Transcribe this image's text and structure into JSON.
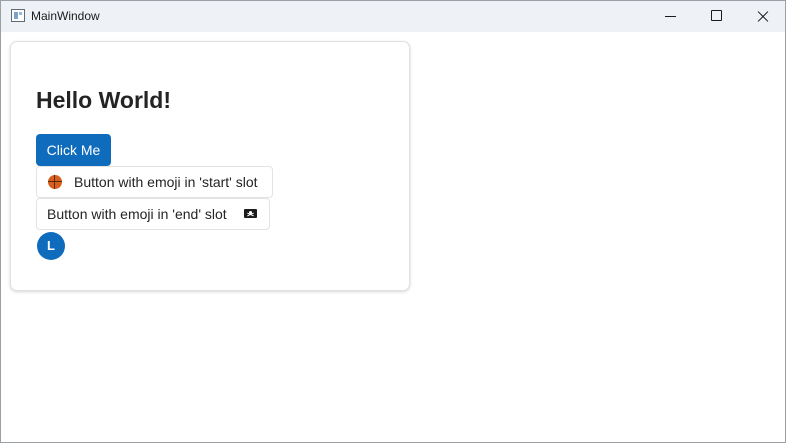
{
  "window": {
    "title": "MainWindow",
    "controls": {
      "minimize": "minimize-icon",
      "maximize": "maximize-icon",
      "close": "close-icon"
    }
  },
  "card": {
    "heading": "Hello World!",
    "primary_button": "Click Me",
    "start_slot_button": {
      "label": "Button with emoji in 'start' slot",
      "icon": "basketball-icon"
    },
    "end_slot_button": {
      "label": "Button with emoji in 'end' slot",
      "icon": "pirate-flag-icon"
    },
    "avatar": {
      "initial": "L"
    }
  },
  "colors": {
    "accent": "#0f6cbd",
    "titlebar": "#eef2f7",
    "text": "#242424",
    "card_border": "#dfe1e5"
  }
}
